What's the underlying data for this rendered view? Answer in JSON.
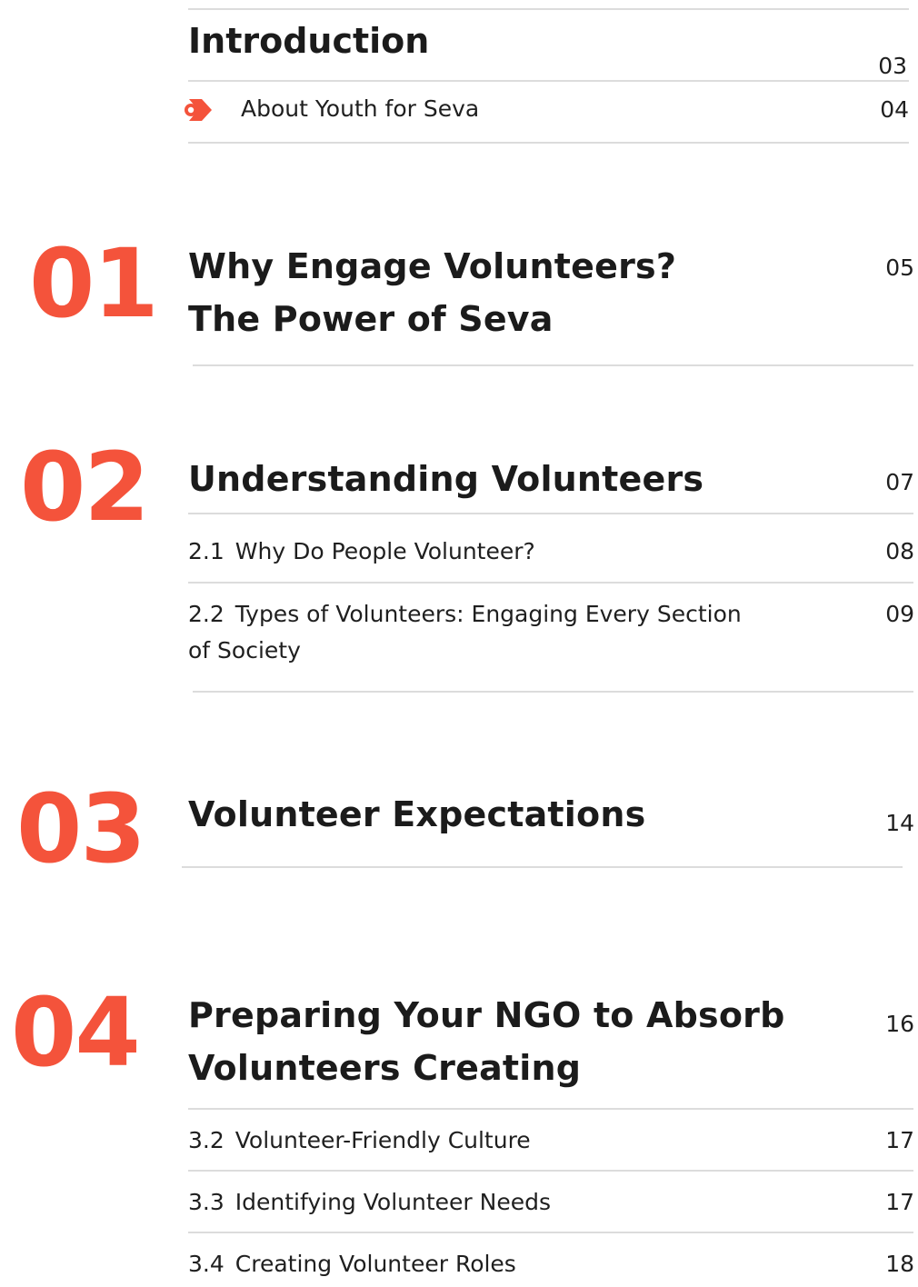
{
  "intro": {
    "heading": "Introduction",
    "page": "03",
    "item": {
      "label": "About Youth for Seva",
      "page": "04",
      "icon": "arrow-icon"
    }
  },
  "chapters": [
    {
      "number": "01",
      "title_line1": "Why Engage Volunteers?",
      "title_line2": "The Power of Seva",
      "page": "05"
    },
    {
      "number": "02",
      "title": "Understanding Volunteers",
      "page": "07",
      "items": [
        {
          "num": "2.1",
          "label": "Why Do People Volunteer?",
          "page": "08"
        },
        {
          "num": "2.2",
          "label_line1": "Types of Volunteers: Engaging Every Section",
          "label_line2": "of Society",
          "page": "09"
        }
      ]
    },
    {
      "number": "03",
      "title": "Volunteer Expectations",
      "page": "14"
    },
    {
      "number": "04",
      "title_line1": "Preparing Your NGO to Absorb",
      "title_line2": "Volunteers Creating",
      "page": "16",
      "items": [
        {
          "num": "3.2",
          "label": "Volunteer-Friendly Culture",
          "page": "17"
        },
        {
          "num": "3.3",
          "label": "Identifying Volunteer Needs",
          "page": "17"
        },
        {
          "num": "3.4",
          "label": "Creating Volunteer Roles",
          "page": "18"
        }
      ]
    }
  ],
  "colors": {
    "accent": "#f4533b",
    "rule": "#dcdcdc",
    "text": "#1f1f1f"
  }
}
